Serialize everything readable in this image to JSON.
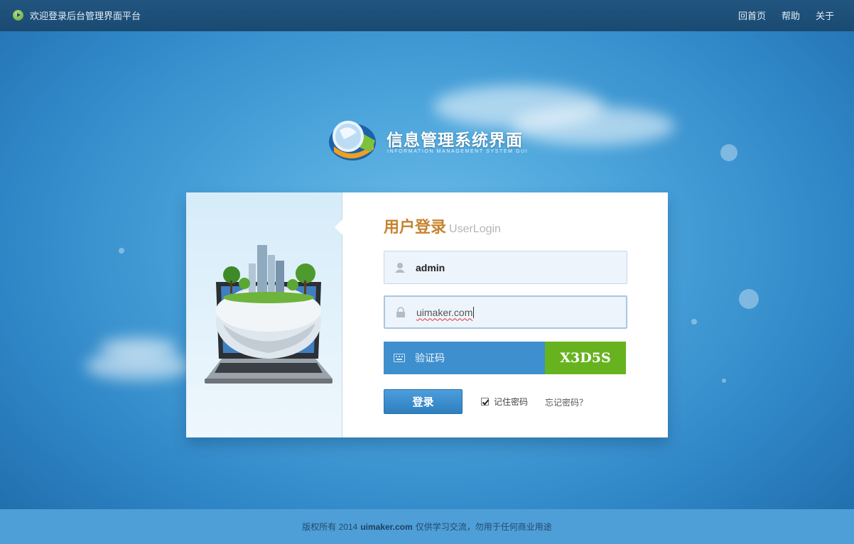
{
  "topbar": {
    "welcome": "欢迎登录后台管理界面平台",
    "nav": [
      "回首页",
      "帮助",
      "关于"
    ]
  },
  "logo": {
    "title": "信息管理系统界面",
    "subtitle": "INFORMATION MANAGEMENT SYSTEM GUI"
  },
  "login": {
    "heading_cn": "用户登录",
    "heading_en": "UserLogin",
    "username": "admin",
    "password": "uimaker.com",
    "captcha_placeholder": "验证码",
    "captcha_code": "X3D5S",
    "submit_label": "登录",
    "remember_label": "记住密码",
    "remember_checked": true,
    "forgot_label": "忘记密码？"
  },
  "footer": {
    "prefix": "版权所有 2014",
    "site": "uimaker.com",
    "suffix": "仅供学习交流，勿用于任何商业用途"
  },
  "colors": {
    "topbar": "#1f5079",
    "heading_accent": "#c6832f",
    "captcha_bg": "#3e8fce",
    "captcha_code_bg": "#67b31f",
    "button": "#3a8bcb",
    "footer": "#4e9fd7"
  }
}
